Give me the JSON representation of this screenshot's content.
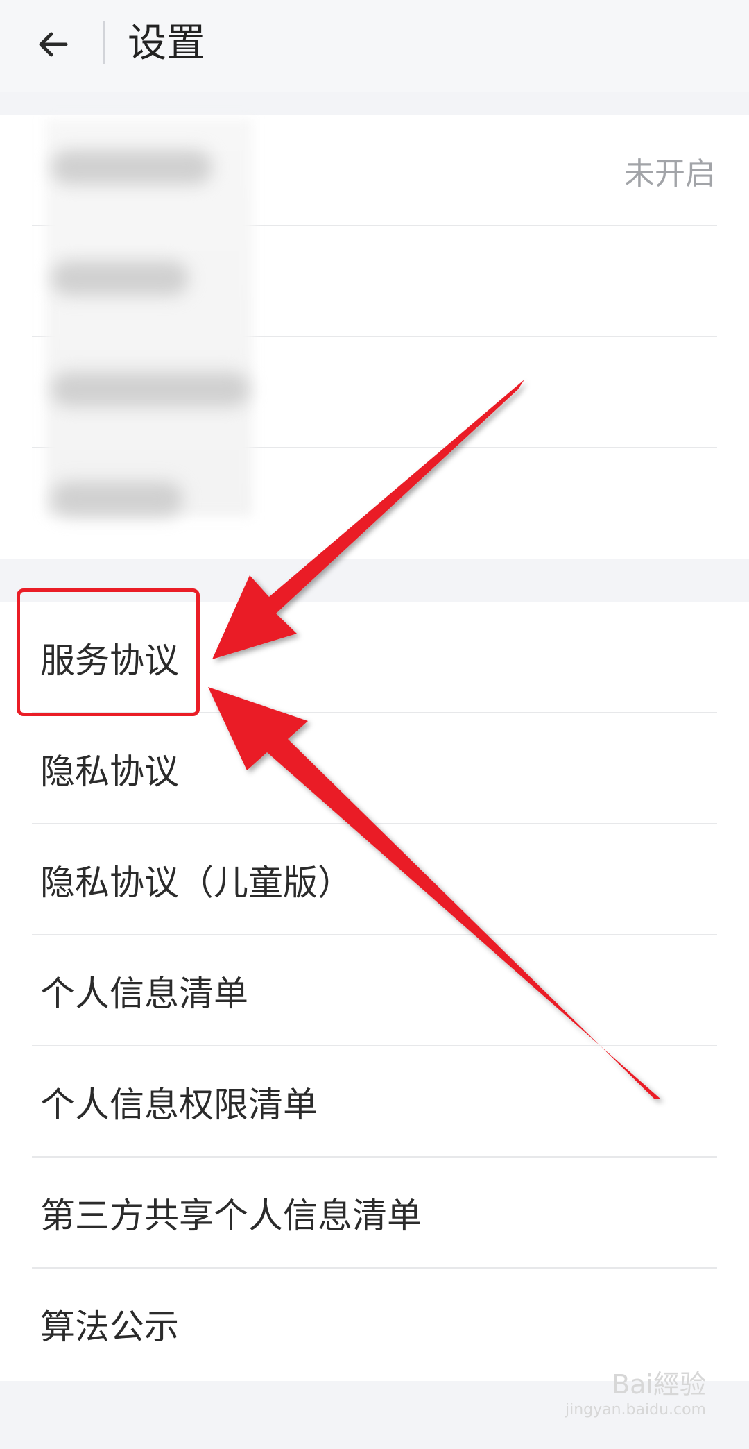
{
  "header": {
    "title": "设置",
    "back_icon": "back-arrow-icon"
  },
  "section_1": {
    "items": [
      {
        "label": "",
        "value": "未开启"
      },
      {
        "label": "",
        "value": ""
      },
      {
        "label": "",
        "value": ""
      },
      {
        "label": "",
        "value": ""
      }
    ]
  },
  "section_2": {
    "items": [
      {
        "label": "服务协议"
      },
      {
        "label": "隐私协议"
      },
      {
        "label": "隐私协议（儿童版）"
      },
      {
        "label": "个人信息清单"
      },
      {
        "label": "个人信息权限清单"
      },
      {
        "label": "第三方共享个人信息清单"
      },
      {
        "label": "算法公示"
      }
    ]
  },
  "annotations": {
    "highlight_target": "服务协议",
    "arrow_color": "#ea1d26"
  },
  "watermark": {
    "main": "Bai經验",
    "sub": "jingyan.baidu.com"
  }
}
